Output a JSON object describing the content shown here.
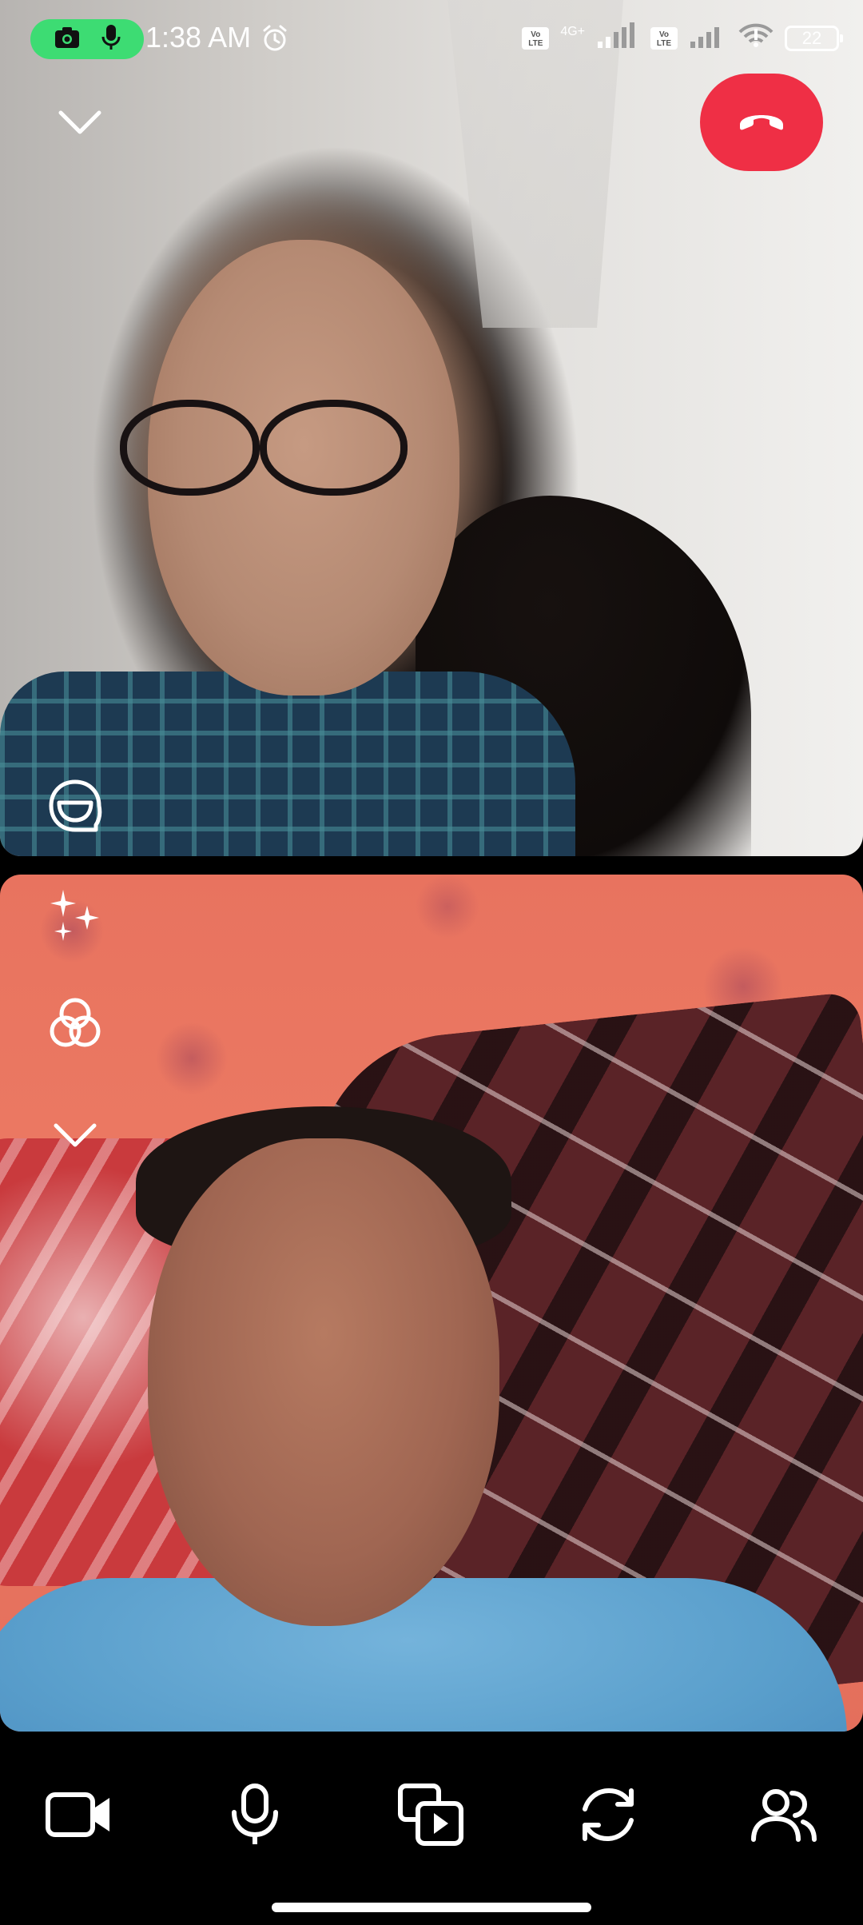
{
  "status_bar": {
    "time": "1:38 AM",
    "network_label": "4G+",
    "volte_label": "Vo LTE",
    "battery_level": "22"
  },
  "call": {
    "end_call_color": "#ef2f45"
  },
  "icons": {
    "collapse": "chevron-down-icon",
    "end_call": "phone-hangup-icon",
    "effects": "face-effects-icon",
    "sparkle": "sparkle-icon",
    "filters": "filters-icon",
    "more": "chevron-down-icon",
    "camera": "video-camera-icon",
    "mic": "microphone-icon",
    "share": "media-share-icon",
    "flip": "flip-camera-icon",
    "participants": "participants-icon"
  },
  "toolbar": {
    "buttons": [
      "camera",
      "microphone",
      "share-media",
      "flip-camera",
      "participants"
    ]
  }
}
